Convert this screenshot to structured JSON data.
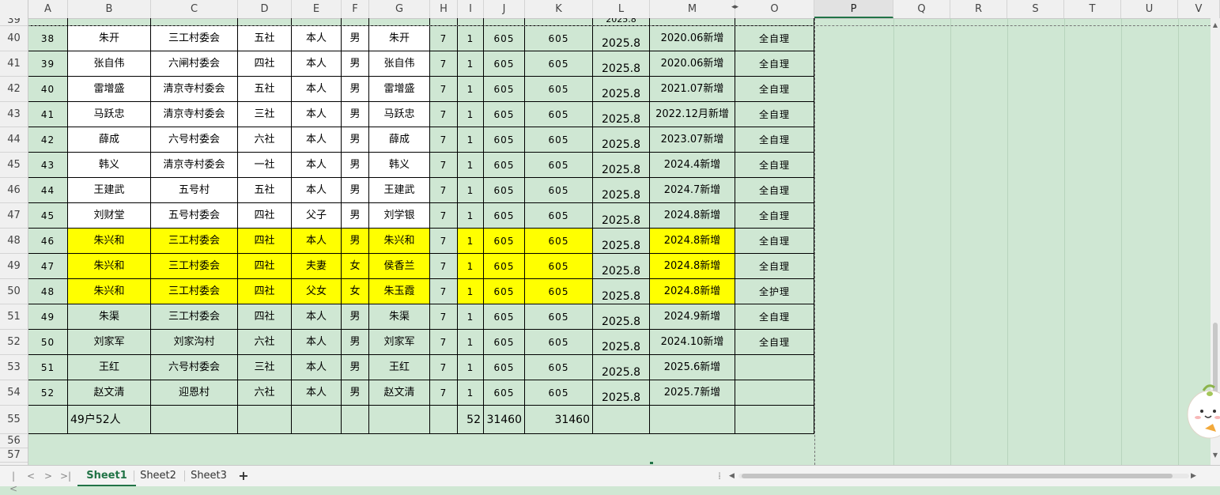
{
  "columns": [
    {
      "label": "A"
    },
    {
      "label": "B"
    },
    {
      "label": "C"
    },
    {
      "label": "D"
    },
    {
      "label": "E"
    },
    {
      "label": "F"
    },
    {
      "label": "G"
    },
    {
      "label": "H"
    },
    {
      "label": "I"
    },
    {
      "label": "J"
    },
    {
      "label": "K"
    },
    {
      "label": "L"
    },
    {
      "label": "M"
    },
    {
      "label": "O"
    },
    {
      "label": "P"
    },
    {
      "label": "Q"
    },
    {
      "label": "R"
    },
    {
      "label": "S"
    },
    {
      "label": "T"
    },
    {
      "label": "U"
    },
    {
      "label": "V"
    }
  ],
  "active_column": "P",
  "rows": [
    {
      "rownum": "39",
      "partial": true,
      "cells": [
        "",
        "",
        "",
        "",
        "",
        "",
        "",
        "",
        "",
        "",
        "",
        "2025.8",
        "",
        ""
      ],
      "highlight": []
    },
    {
      "rownum": "40",
      "cells": [
        "38",
        "朱开",
        "三工村委会",
        "五社",
        "本人",
        "男",
        "朱开",
        "7",
        "1",
        "605",
        "605",
        "2025.8",
        "2020.06新增",
        "全自理"
      ],
      "highlight": []
    },
    {
      "rownum": "41",
      "cells": [
        "39",
        "张自伟",
        "六闸村委会",
        "四社",
        "本人",
        "男",
        "张自伟",
        "7",
        "1",
        "605",
        "605",
        "2025.8",
        "2020.06新增",
        "全自理"
      ],
      "highlight": []
    },
    {
      "rownum": "42",
      "cells": [
        "40",
        "雷增盛",
        "清京寺村委会",
        "五社",
        "本人",
        "男",
        "雷增盛",
        "7",
        "1",
        "605",
        "605",
        "2025.8",
        "2021.07新增",
        "全自理"
      ],
      "highlight": []
    },
    {
      "rownum": "43",
      "cells": [
        "41",
        "马跃忠",
        "清京寺村委会",
        "三社",
        "本人",
        "男",
        "马跃忠",
        "7",
        "1",
        "605",
        "605",
        "2025.8",
        "2022.12月新增",
        "全自理"
      ],
      "highlight": []
    },
    {
      "rownum": "44",
      "cells": [
        "42",
        "薛成",
        "六号村委会",
        "六社",
        "本人",
        "男",
        "薛成",
        "7",
        "1",
        "605",
        "605",
        "2025.8",
        "2023.07新增",
        "全自理"
      ],
      "highlight": []
    },
    {
      "rownum": "45",
      "cells": [
        "43",
        "韩义",
        "清京寺村委会",
        "一社",
        "本人",
        "男",
        "韩义",
        "7",
        "1",
        "605",
        "605",
        "2025.8",
        "2024.4新增",
        "全自理"
      ],
      "highlight": []
    },
    {
      "rownum": "46",
      "cells": [
        "44",
        "王建武",
        "五号村",
        "五社",
        "本人",
        "男",
        "王建武",
        "7",
        "1",
        "605",
        "605",
        "2025.8",
        "2024.7新增",
        "全自理"
      ],
      "highlight": []
    },
    {
      "rownum": "47",
      "cells": [
        "45",
        "刘财堂",
        "五号村委会",
        "四社",
        "父子",
        "男",
        "刘学银",
        "7",
        "1",
        "605",
        "605",
        "2025.8",
        "2024.8新增",
        "全自理"
      ],
      "highlight": []
    },
    {
      "rownum": "48",
      "cells": [
        "46",
        "朱兴和",
        "三工村委会",
        "四社",
        "本人",
        "男",
        "朱兴和",
        "7",
        "1",
        "605",
        "605",
        "2025.8",
        "2024.8新增",
        "全自理"
      ],
      "highlight": [
        "B",
        "C",
        "D",
        "E",
        "F",
        "G",
        "I",
        "J",
        "K",
        "M"
      ]
    },
    {
      "rownum": "49",
      "cells": [
        "47",
        "朱兴和",
        "三工村委会",
        "四社",
        "夫妻",
        "女",
        "侯香兰",
        "7",
        "1",
        "605",
        "605",
        "2025.8",
        "2024.8新增",
        "全自理"
      ],
      "highlight": [
        "B",
        "C",
        "D",
        "E",
        "F",
        "G",
        "I",
        "J",
        "K",
        "M"
      ]
    },
    {
      "rownum": "50",
      "cells": [
        "48",
        "朱兴和",
        "三工村委会",
        "四社",
        "父女",
        "女",
        "朱玉霞",
        "7",
        "1",
        "605",
        "605",
        "2025.8",
        "2024.8新增",
        "全护理"
      ],
      "highlight": [
        "B",
        "C",
        "D",
        "E",
        "F",
        "G",
        "I",
        "J",
        "K",
        "M"
      ]
    },
    {
      "rownum": "51",
      "cells": [
        "49",
        "朱渠",
        "三工村委会",
        "四社",
        "本人",
        "男",
        "朱渠",
        "7",
        "1",
        "605",
        "605",
        "2025.8",
        "2024.9新增",
        "全自理"
      ],
      "highlight": []
    },
    {
      "rownum": "52",
      "cells": [
        "50",
        "刘家军",
        "刘家沟村",
        "六社",
        "本人",
        "男",
        "刘家军",
        "7",
        "1",
        "605",
        "605",
        "2025.8",
        "2024.10新增",
        "全自理"
      ],
      "highlight": []
    },
    {
      "rownum": "53",
      "cells": [
        "51",
        "王红",
        "六号村委会",
        "三社",
        "本人",
        "男",
        "王红",
        "7",
        "1",
        "605",
        "605",
        "2025.8",
        "2025.6新增",
        ""
      ],
      "highlight": []
    },
    {
      "rownum": "54",
      "cells": [
        "52",
        "赵文清",
        "迎恩村",
        "六社",
        "本人",
        "男",
        "赵文清",
        "7",
        "1",
        "605",
        "605",
        "2025.8",
        "2025.7新增",
        ""
      ],
      "highlight": []
    }
  ],
  "total_row": {
    "rownum": "55",
    "b": "49户52人",
    "i": "52",
    "j": "31460",
    "k": "31460"
  },
  "empty_rows": [
    {
      "rownum": "56"
    },
    {
      "rownum": "57"
    }
  ],
  "sheets": [
    {
      "label": "Sheet1",
      "active": true
    },
    {
      "label": "Sheet2",
      "active": false
    },
    {
      "label": "Sheet3",
      "active": false
    }
  ],
  "add_sheet_label": "+",
  "colors": {
    "highlight": "#ffff00",
    "grid_bg": "#cfe7d3",
    "accent": "#217346"
  }
}
